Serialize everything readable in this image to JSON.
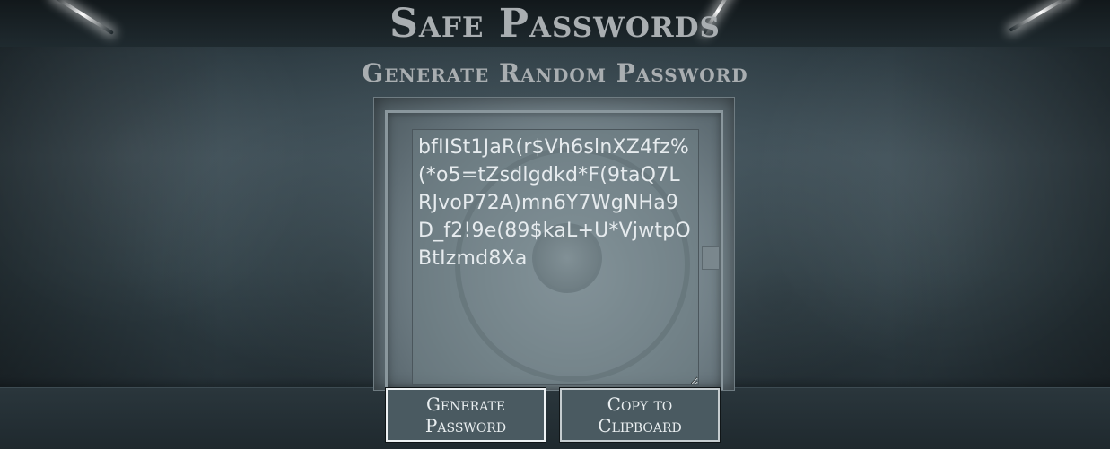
{
  "header": {
    "title": "Safe Passwords",
    "subtitle": "Generate Random Password"
  },
  "password": {
    "value": "bfIISt1JaR(r$Vh6slnXZ4fz%(*o5=tZsdlgdkd*F(9taQ7LRJvoP72A)mn6Y7WgNHa9D_f2!9e(89$kaL+U*VjwtpOBtIzmd8Xa"
  },
  "actions": {
    "generate_label": "Generate Password",
    "copy_label": "Copy to Clipboard"
  },
  "colors": {
    "text_title": "#a9aeb1",
    "button_bg": "#4a5a61",
    "button_border": "#c6cdd0",
    "password_text": "#e6ebee"
  }
}
